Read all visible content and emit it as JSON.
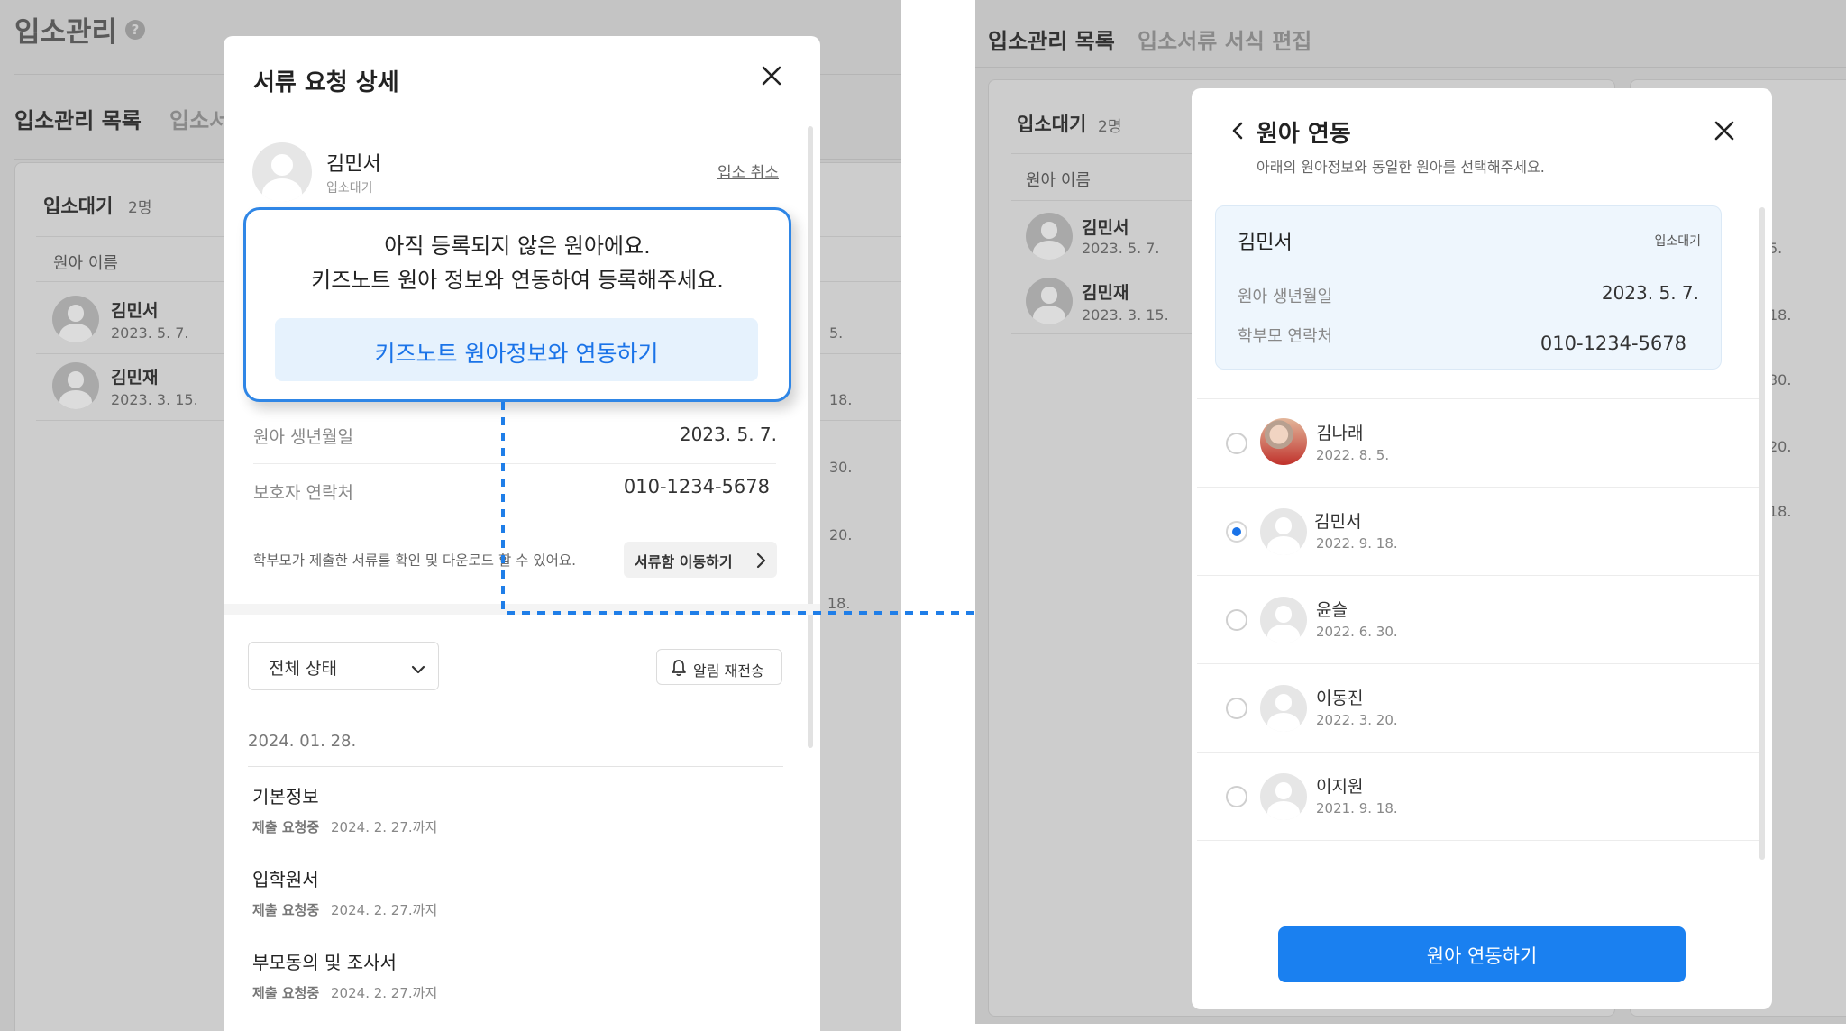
{
  "left_screen": {
    "page_title": "입소관리",
    "tabs": [
      "입소관리 목록",
      "입소서"
    ],
    "waiting_label": "입소대기",
    "waiting_count": "2명",
    "column_name": "원아 이름",
    "children": [
      {
        "name": "김민서",
        "date": "2023. 5. 7."
      },
      {
        "name": "김민재",
        "date": "2023. 3. 15."
      }
    ],
    "right_dates": [
      "5.",
      "18.",
      "30.",
      "20.",
      "18."
    ]
  },
  "doc_modal": {
    "title": "서류 요청 상세",
    "child_name": "김민서",
    "child_status": "입소대기",
    "cancel_link": "입소 취소",
    "birth_label": "원아 생년월일",
    "birth_value": "2023. 5. 7.",
    "contact_label": "보호자 연락처",
    "contact_value": "010-1234-5678",
    "info_text": "학부모가 제출한 서류를 확인 및 다운로드 할 수 있어요.",
    "move_button": "서류함 이동하기",
    "filter_value": "전체 상태",
    "resend_button": "알림 재전송",
    "date_header": "2024. 01. 28.",
    "docs": [
      {
        "title": "기본정보",
        "status": "제출 요청중",
        "due": "2024. 2. 27.까지"
      },
      {
        "title": "입학원서",
        "status": "제출 요청중",
        "due": "2024. 2. 27.까지"
      },
      {
        "title": "부모동의 및 조사서",
        "status": "제출 요청중",
        "due": "2024. 2. 27.까지"
      }
    ]
  },
  "callout": {
    "line1": "아직 등록되지 않은 원아에요.",
    "line2": "키즈노트 원아 정보와 연동하여 등록해주세요.",
    "button": "키즈노트 원아정보와 연동하기"
  },
  "right_screen": {
    "tabs": [
      "입소관리 목록",
      "입소서류 서식 편집"
    ],
    "waiting_label": "입소대기",
    "waiting_count": "2명",
    "column_name": "원아 이름",
    "children": [
      {
        "name": "김민서",
        "date": "2023. 5. 7."
      },
      {
        "name": "김민재",
        "date": "2023. 3. 15."
      }
    ],
    "right_dates": [
      "5.",
      "18.",
      "30.",
      "20.",
      "18."
    ]
  },
  "link_modal": {
    "title": "원아 연동",
    "subtitle": "아래의 원아정보와 동일한 원아를 선택해주세요.",
    "card": {
      "name": "김민서",
      "status": "입소대기",
      "birth_label": "원아 생년월일",
      "birth_value": "2023. 5. 7.",
      "contact_label": "학부모 연락처",
      "contact_value": "010-1234-5678"
    },
    "options": [
      {
        "name": "김나래",
        "date": "2022. 8. 5.",
        "selected": false,
        "photo": true
      },
      {
        "name": "김민서",
        "date": "2022. 9. 18.",
        "selected": true,
        "photo": false
      },
      {
        "name": "윤슬",
        "date": "2022. 6. 30.",
        "selected": false,
        "photo": false
      },
      {
        "name": "이동진",
        "date": "2022. 3. 20.",
        "selected": false,
        "photo": false
      },
      {
        "name": "이지원",
        "date": "2021. 9. 18.",
        "selected": false,
        "photo": false
      }
    ],
    "confirm_button": "원아 연동하기"
  },
  "colors": {
    "accent": "#1a73e8",
    "callout_border": "#2f86e6",
    "callout_button_bg": "#e6f2fd",
    "card_bg": "#eef6fd",
    "dim_bg": "#c4c4c4"
  },
  "icons": [
    "help-icon",
    "close-icon",
    "chevron-right-icon",
    "chevron-down-icon",
    "bell-icon",
    "back-chevron-icon",
    "arrow-right-icon"
  ]
}
